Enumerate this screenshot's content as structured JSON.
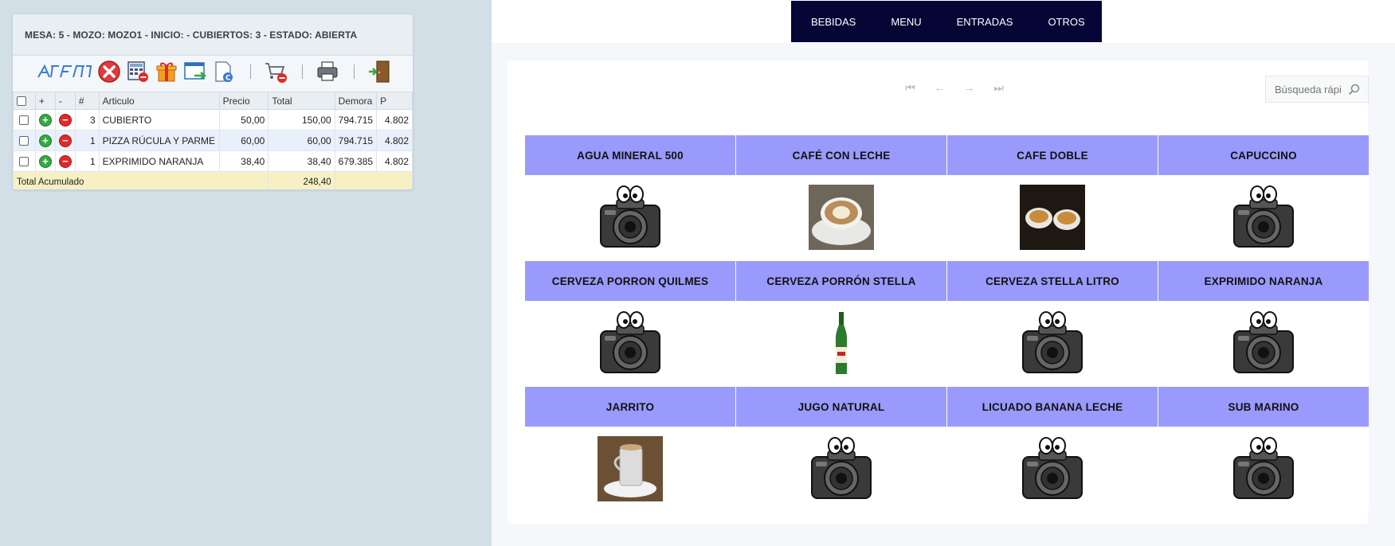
{
  "order": {
    "header": "MESA: 5 - MOZO: MOZO1 - INICIO: - CUBIERTOS: 3 - ESTADO: ABIERTA",
    "columns": [
      "+",
      "-",
      "#",
      "Articulo",
      "Precio",
      "Total",
      "Demora",
      "P"
    ],
    "rows": [
      {
        "qty": "3",
        "articulo": "CUBIERTO",
        "precio": "50,00",
        "total": "150,00",
        "demora": "794.715",
        "p": "4.802"
      },
      {
        "qty": "1",
        "articulo": "PIZZA RÚCULA Y PARME",
        "precio": "60,00",
        "total": "60,00",
        "demora": "794.715",
        "p": "4.802"
      },
      {
        "qty": "1",
        "articulo": "EXPRIMIDO NARANJA",
        "precio": "38,40",
        "total": "38,40",
        "demora": "679.385",
        "p": "4.802"
      }
    ],
    "total_label": "Total Acumulado",
    "total_value": "248,40"
  },
  "toolbar": {
    "icons": [
      "logo-icon",
      "cancel-icon",
      "calculator-delete-icon",
      "gift-icon",
      "window-transfer-icon",
      "document-c-icon",
      "cart-remove-icon",
      "printer-icon",
      "exit-door-icon"
    ]
  },
  "nav": {
    "items": [
      "BEBIDAS",
      "MENU",
      "ENTRADAS",
      "OTROS"
    ]
  },
  "search": {
    "placeholder": "Búsqueda rápi"
  },
  "products": [
    {
      "name": "AGUA MINERAL 500",
      "image": "placeholder-camera"
    },
    {
      "name": "CAFÉ CON LECHE",
      "image": "coffee-photo"
    },
    {
      "name": "CAFE DOBLE",
      "image": "double-coffee-photo"
    },
    {
      "name": "CAPUCCINO",
      "image": "placeholder-camera"
    },
    {
      "name": "CERVEZA PORRON QUILMES",
      "image": "placeholder-camera"
    },
    {
      "name": "CERVEZA PORRÓN STELLA",
      "image": "beer-bottle-photo"
    },
    {
      "name": "CERVEZA STELLA LITRO",
      "image": "placeholder-camera"
    },
    {
      "name": "EXPRIMIDO NARANJA",
      "image": "placeholder-camera"
    },
    {
      "name": "JARRITO",
      "image": "cup-photo"
    },
    {
      "name": "JUGO NATURAL",
      "image": "placeholder-camera"
    },
    {
      "name": "LICUADO BANANA LECHE",
      "image": "placeholder-camera"
    },
    {
      "name": "SUB MARINO",
      "image": "placeholder-camera"
    }
  ],
  "colors": {
    "nav_bg": "#050536",
    "product_header": "#9a9afc",
    "left_bg": "#d3dfe7",
    "total_row": "#f6f0c4"
  }
}
